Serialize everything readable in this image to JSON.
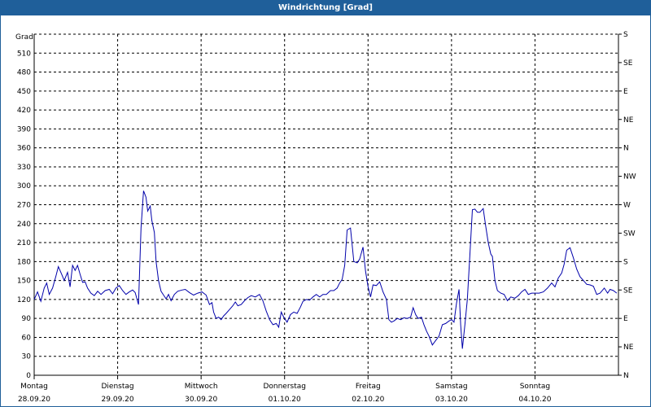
{
  "window": {
    "title": "Windrichtung [Grad]"
  },
  "chart_data": {
    "type": "line",
    "title": "Windrichtung [Grad]",
    "ylabel": "Grad",
    "ylim": [
      0,
      540
    ],
    "yticks": [
      0,
      30,
      60,
      90,
      120,
      150,
      180,
      210,
      240,
      270,
      300,
      330,
      360,
      390,
      420,
      450,
      480,
      510
    ],
    "y2ticks": [
      {
        "value": 0,
        "label": "N"
      },
      {
        "value": 45,
        "label": "NE"
      },
      {
        "value": 90,
        "label": "E"
      },
      {
        "value": 135,
        "label": "SE"
      },
      {
        "value": 180,
        "label": "S"
      },
      {
        "value": 225,
        "label": "SW"
      },
      {
        "value": 270,
        "label": "W"
      },
      {
        "value": 315,
        "label": "NW"
      },
      {
        "value": 360,
        "label": "N"
      },
      {
        "value": 405,
        "label": "NE"
      },
      {
        "value": 450,
        "label": "E"
      },
      {
        "value": 495,
        "label": "SE"
      },
      {
        "value": 540,
        "label": "S"
      }
    ],
    "xlim": [
      0,
      7
    ],
    "xticks": [
      {
        "day": 0,
        "weekday": "Montag",
        "date": "28.09.20"
      },
      {
        "day": 1,
        "weekday": "Dienstag",
        "date": "29.09.20"
      },
      {
        "day": 2,
        "weekday": "Mittwoch",
        "date": "30.09.20"
      },
      {
        "day": 3,
        "weekday": "Donnerstag",
        "date": "01.10.20"
      },
      {
        "day": 4,
        "weekday": "Freitag",
        "date": "02.10.20"
      },
      {
        "day": 5,
        "weekday": "Samstag",
        "date": "03.10.20"
      },
      {
        "day": 6,
        "weekday": "Sonntag",
        "date": "04.10.20"
      }
    ],
    "grid": true,
    "line_color": "#0000aa",
    "series": [
      {
        "points": [
          [
            0.0,
            120
          ],
          [
            0.04,
            132
          ],
          [
            0.08,
            117
          ],
          [
            0.12,
            138
          ],
          [
            0.15,
            146
          ],
          [
            0.18,
            128
          ],
          [
            0.22,
            138
          ],
          [
            0.26,
            157
          ],
          [
            0.29,
            172
          ],
          [
            0.33,
            160
          ],
          [
            0.36,
            150
          ],
          [
            0.4,
            163
          ],
          [
            0.43,
            140
          ],
          [
            0.46,
            174
          ],
          [
            0.49,
            166
          ],
          [
            0.52,
            174
          ],
          [
            0.55,
            160
          ],
          [
            0.58,
            147
          ],
          [
            0.61,
            148
          ],
          [
            0.64,
            138
          ],
          [
            0.68,
            130
          ],
          [
            0.72,
            126
          ],
          [
            0.76,
            133
          ],
          [
            0.8,
            128
          ],
          [
            0.85,
            134
          ],
          [
            0.9,
            136
          ],
          [
            0.94,
            129
          ],
          [
            0.98,
            138
          ],
          [
            1.02,
            142
          ],
          [
            1.06,
            134
          ],
          [
            1.1,
            128
          ],
          [
            1.14,
            132
          ],
          [
            1.18,
            135
          ],
          [
            1.21,
            131
          ],
          [
            1.25,
            112
          ],
          [
            1.28,
            233
          ],
          [
            1.31,
            292
          ],
          [
            1.34,
            282
          ],
          [
            1.36,
            260
          ],
          [
            1.39,
            268
          ],
          [
            1.41,
            245
          ],
          [
            1.44,
            226
          ],
          [
            1.46,
            180
          ],
          [
            1.49,
            150
          ],
          [
            1.52,
            133
          ],
          [
            1.55,
            127
          ],
          [
            1.58,
            121
          ],
          [
            1.61,
            128
          ],
          [
            1.64,
            118
          ],
          [
            1.68,
            128
          ],
          [
            1.72,
            133
          ],
          [
            1.77,
            135
          ],
          [
            1.81,
            136
          ],
          [
            1.86,
            131
          ],
          [
            1.91,
            127
          ],
          [
            1.96,
            130
          ],
          [
            2.01,
            132
          ],
          [
            2.06,
            127
          ],
          [
            2.1,
            112
          ],
          [
            2.13,
            115
          ],
          [
            2.15,
            100
          ],
          [
            2.18,
            90
          ],
          [
            2.21,
            92
          ],
          [
            2.24,
            88
          ],
          [
            2.27,
            94
          ],
          [
            2.3,
            98
          ],
          [
            2.34,
            104
          ],
          [
            2.38,
            110
          ],
          [
            2.41,
            116
          ],
          [
            2.44,
            110
          ],
          [
            2.48,
            112
          ],
          [
            2.52,
            118
          ],
          [
            2.56,
            123
          ],
          [
            2.6,
            126
          ],
          [
            2.65,
            124
          ],
          [
            2.7,
            128
          ],
          [
            2.74,
            118
          ],
          [
            2.78,
            102
          ],
          [
            2.82,
            88
          ],
          [
            2.86,
            80
          ],
          [
            2.9,
            82
          ],
          [
            2.93,
            76
          ],
          [
            2.96,
            100
          ],
          [
            2.99,
            92
          ],
          [
            3.03,
            84
          ],
          [
            3.07,
            96
          ],
          [
            3.11,
            100
          ],
          [
            3.15,
            98
          ],
          [
            3.19,
            108
          ],
          [
            3.22,
            117
          ],
          [
            3.26,
            120
          ],
          [
            3.3,
            119
          ],
          [
            3.34,
            124
          ],
          [
            3.38,
            128
          ],
          [
            3.42,
            124
          ],
          [
            3.46,
            128
          ],
          [
            3.5,
            128
          ],
          [
            3.55,
            134
          ],
          [
            3.59,
            134
          ],
          [
            3.63,
            138
          ],
          [
            3.66,
            146
          ],
          [
            3.69,
            152
          ],
          [
            3.72,
            174
          ],
          [
            3.75,
            230
          ],
          [
            3.79,
            233
          ],
          [
            3.83,
            180
          ],
          [
            3.87,
            178
          ],
          [
            3.9,
            184
          ],
          [
            3.94,
            203
          ],
          [
            3.97,
            165
          ],
          [
            4.0,
            140
          ],
          [
            4.03,
            124
          ],
          [
            4.06,
            143
          ],
          [
            4.1,
            142
          ],
          [
            4.14,
            148
          ],
          [
            4.18,
            132
          ],
          [
            4.22,
            120
          ],
          [
            4.25,
            88
          ],
          [
            4.28,
            84
          ],
          [
            4.31,
            86
          ],
          [
            4.35,
            90
          ],
          [
            4.39,
            88
          ],
          [
            4.43,
            91
          ],
          [
            4.47,
            90
          ],
          [
            4.51,
            92
          ],
          [
            4.54,
            107
          ],
          [
            4.57,
            96
          ],
          [
            4.6,
            90
          ],
          [
            4.64,
            92
          ],
          [
            4.67,
            80
          ],
          [
            4.7,
            70
          ],
          [
            4.73,
            62
          ],
          [
            4.77,
            48
          ],
          [
            4.81,
            55
          ],
          [
            4.85,
            62
          ],
          [
            4.89,
            80
          ],
          [
            4.93,
            82
          ],
          [
            4.97,
            86
          ],
          [
            5.0,
            88
          ],
          [
            5.03,
            84
          ],
          [
            5.06,
            114
          ],
          [
            5.09,
            136
          ],
          [
            5.11,
            80
          ],
          [
            5.13,
            42
          ],
          [
            5.16,
            80
          ],
          [
            5.19,
            120
          ],
          [
            5.22,
            190
          ],
          [
            5.25,
            262
          ],
          [
            5.28,
            263
          ],
          [
            5.31,
            258
          ],
          [
            5.34,
            258
          ],
          [
            5.38,
            264
          ],
          [
            5.41,
            236
          ],
          [
            5.44,
            210
          ],
          [
            5.47,
            192
          ],
          [
            5.49,
            188
          ],
          [
            5.52,
            150
          ],
          [
            5.55,
            134
          ],
          [
            5.59,
            130
          ],
          [
            5.63,
            128
          ],
          [
            5.67,
            118
          ],
          [
            5.71,
            124
          ],
          [
            5.76,
            122
          ],
          [
            5.8,
            126
          ],
          [
            5.84,
            132
          ],
          [
            5.88,
            136
          ],
          [
            5.92,
            128
          ],
          [
            5.96,
            130
          ],
          [
            6.0,
            130
          ],
          [
            6.05,
            130
          ],
          [
            6.1,
            132
          ],
          [
            6.15,
            138
          ],
          [
            6.2,
            146
          ],
          [
            6.24,
            140
          ],
          [
            6.28,
            154
          ],
          [
            6.32,
            162
          ],
          [
            6.35,
            176
          ],
          [
            6.38,
            198
          ],
          [
            6.42,
            202
          ],
          [
            6.46,
            186
          ],
          [
            6.5,
            168
          ],
          [
            6.54,
            156
          ],
          [
            6.58,
            150
          ],
          [
            6.62,
            144
          ],
          [
            6.66,
            143
          ],
          [
            6.7,
            141
          ],
          [
            6.74,
            128
          ],
          [
            6.78,
            130
          ],
          [
            6.83,
            138
          ],
          [
            6.87,
            130
          ],
          [
            6.9,
            136
          ],
          [
            6.94,
            134
          ],
          [
            6.98,
            130
          ]
        ]
      }
    ]
  }
}
